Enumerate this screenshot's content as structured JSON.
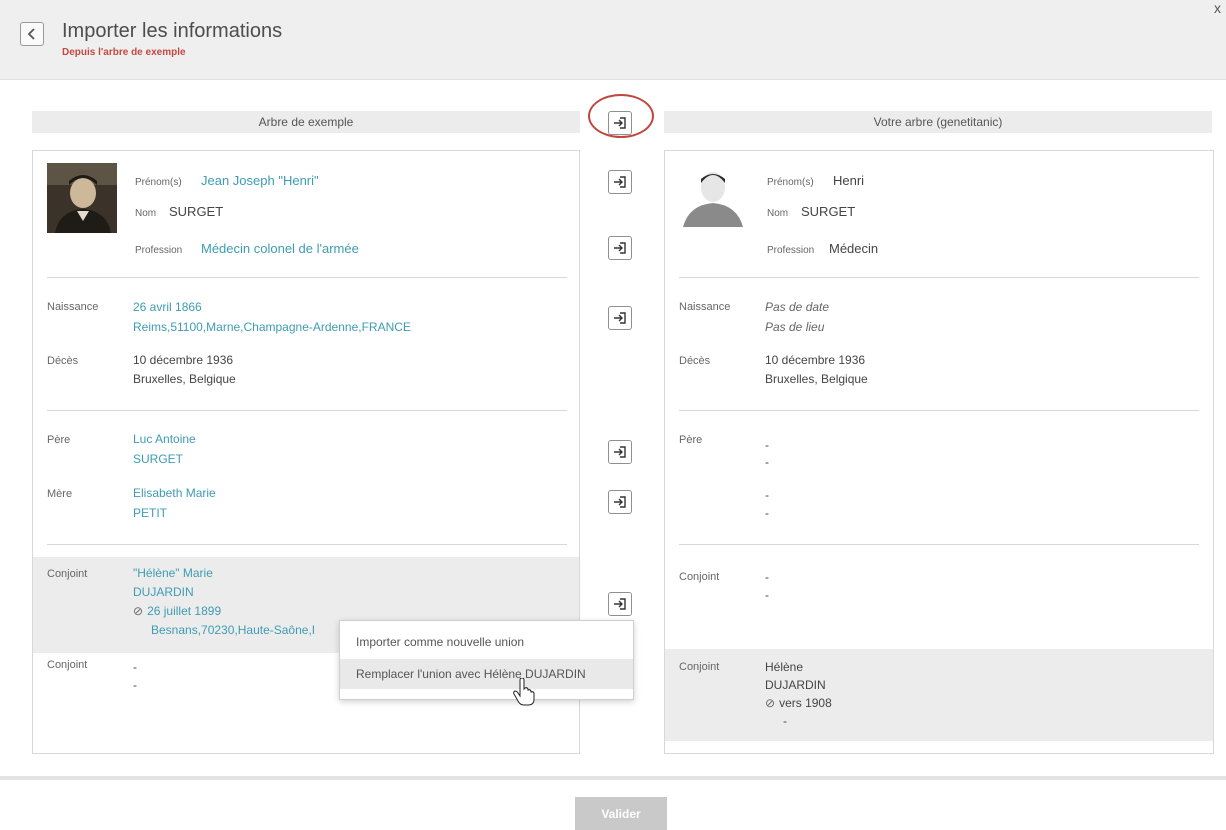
{
  "header": {
    "title": "Importer les informations",
    "subtitle": "Depuis l'arbre de exemple",
    "close": "x"
  },
  "columns": {
    "left_title": "Arbre de exemple",
    "right_title": "Votre arbre (genetitanic)"
  },
  "labels": {
    "prenoms": "Prénom(s)",
    "nom": "Nom",
    "profession": "Profession",
    "naissance": "Naissance",
    "deces": "Décès",
    "pere": "Père",
    "mere": "Mère",
    "conjoint": "Conjoint"
  },
  "source": {
    "prenoms": "Jean Joseph \"Henri\"",
    "nom": "SURGET",
    "profession": "Médecin colonel de l'armée",
    "naissance_date": "26 avril 1866",
    "naissance_lieu": "Reims,51100,Marne,Champagne-Ardenne,FRANCE",
    "deces_date": "10 décembre 1936",
    "deces_lieu": "Bruxelles, Belgique",
    "pere_prenom": "Luc Antoine",
    "pere_nom": "SURGET",
    "mere_prenom": "Elisabeth Marie",
    "mere_nom": "PETIT",
    "conjoint1_prenom": "\"Hélène\" Marie",
    "conjoint1_nom": "DUJARDIN",
    "conjoint1_mariage": "26 juillet 1899",
    "conjoint1_lieu": "Besnans,70230,Haute-Saône,I",
    "conjoint2_a": "-",
    "conjoint2_b": "-"
  },
  "target": {
    "prenoms": "Henri",
    "nom": "SURGET",
    "profession": "Médecin",
    "naissance_date": "Pas de date",
    "naissance_lieu": "Pas de lieu",
    "deces_date": "10 décembre 1936",
    "deces_lieu": "Bruxelles, Belgique",
    "pere_a": "-",
    "pere_b": "-",
    "mere_a": "-",
    "mere_b": "-",
    "conjoint1_a": "-",
    "conjoint1_b": "-",
    "conjoint2_prenom": "Hélène",
    "conjoint2_nom": "DUJARDIN",
    "conjoint2_mariage": "vers 1908",
    "conjoint2_lieu": "-"
  },
  "menu": {
    "item1": "Importer comme nouvelle union",
    "item2": "Remplacer l'union avec Hélène DUJARDIN"
  },
  "footer": {
    "validate": "Valider"
  },
  "colors": {
    "link": "#3d9cb3",
    "accent_red": "#c0473d",
    "disabled_button": "#c9c9c9"
  }
}
